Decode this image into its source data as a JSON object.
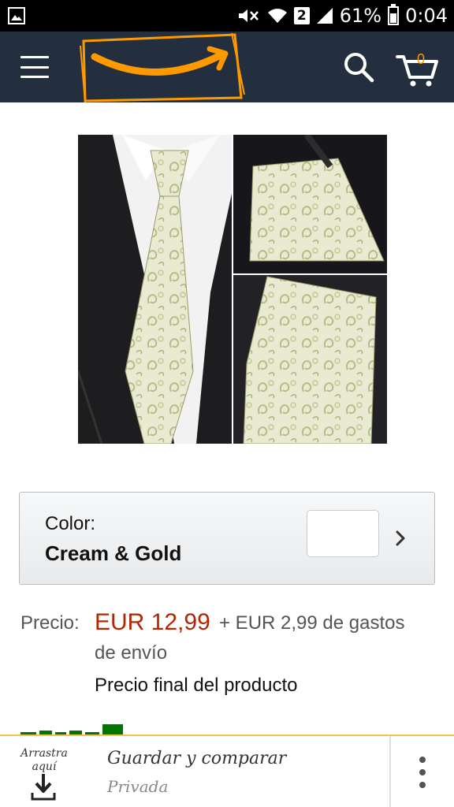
{
  "status_bar": {
    "sim_slot": "2",
    "battery_percent": "61%",
    "battery_level": 0.61,
    "time": "0:04",
    "icons": [
      "gallery-notification-icon",
      "mute-icon",
      "wifi-icon",
      "sim-icon",
      "signal-icon",
      "battery-icon"
    ]
  },
  "header": {
    "icons": [
      "menu-icon",
      "amazon-logo",
      "search-icon",
      "cart-icon"
    ],
    "cart_count": "0",
    "colors": {
      "background": "#232f3e",
      "accent": "#ff9900"
    }
  },
  "product": {
    "image": "product-image-tie-set"
  },
  "color_selector": {
    "label": "Color:",
    "value": "Cream & Gold"
  },
  "price": {
    "label": "Precio:",
    "value": "EUR 12,99",
    "shipping_line1": "+ EUR 2,99 de gastos",
    "shipping_line2": "de envío",
    "final_note": "Precio final del producto",
    "price_color": "#b12704"
  },
  "clip_bar": {
    "drag_label_line1": "Arrastra",
    "drag_label_line2": "aquí",
    "save_title": "Guardar y comparar",
    "save_subtitle": "Privada",
    "icons": [
      "download-icon",
      "more-vert-icon"
    ]
  }
}
